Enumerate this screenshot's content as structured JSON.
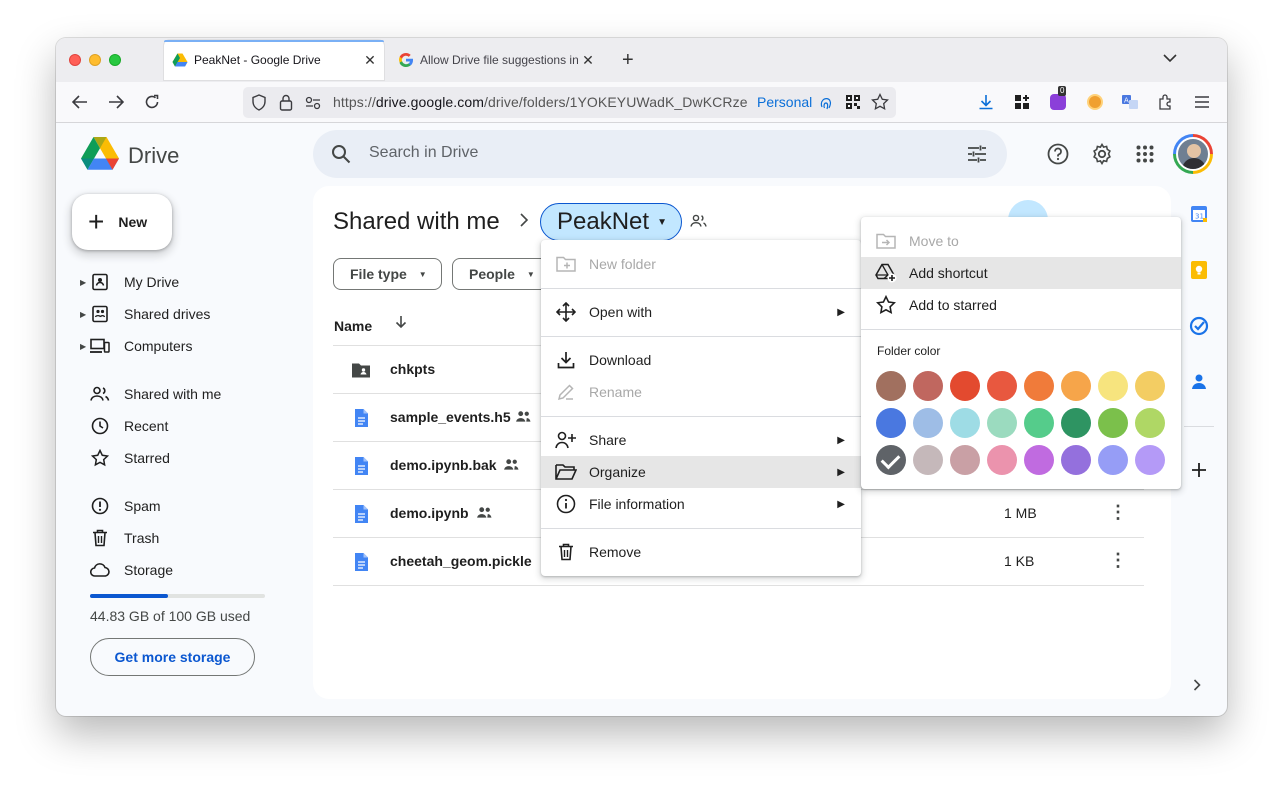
{
  "browser": {
    "tabs": [
      {
        "title": "PeakNet - Google Drive",
        "active": true
      },
      {
        "title": "Allow Drive file suggestions in C",
        "active": false
      }
    ],
    "url": "https://drive.google.com/drive/folders/1YOKEYUWadK_DwKCRze",
    "url_domain": "drive.google.com",
    "container_label": "Personal",
    "extension_badge": "0"
  },
  "drive": {
    "app_name": "Drive",
    "search_placeholder": "Search in Drive",
    "new_label": "New",
    "nav": [
      {
        "label": "My Drive",
        "icon": "my-drive-icon",
        "expandable": true
      },
      {
        "label": "Shared drives",
        "icon": "shared-drives-icon",
        "expandable": true
      },
      {
        "label": "Computers",
        "icon": "computers-icon",
        "expandable": true
      },
      {
        "label": "Shared with me",
        "icon": "shared-with-me-icon",
        "expandable": false
      },
      {
        "label": "Recent",
        "icon": "clock-icon",
        "expandable": false
      },
      {
        "label": "Starred",
        "icon": "star-icon",
        "expandable": false
      },
      {
        "label": "Spam",
        "icon": "spam-icon",
        "expandable": false
      },
      {
        "label": "Trash",
        "icon": "trash-icon",
        "expandable": false
      },
      {
        "label": "Storage",
        "icon": "cloud-icon",
        "expandable": false
      }
    ],
    "storage": {
      "used_text": "44.83 GB of 100 GB used",
      "used_fraction": 0.4483,
      "button": "Get more storage"
    },
    "breadcrumb": {
      "root": "Shared with me",
      "current": "PeakNet"
    },
    "filters": [
      "File type",
      "People"
    ],
    "columns": {
      "name": "Name"
    },
    "files": [
      {
        "name": "chkpts",
        "type": "shared-folder",
        "shared": false,
        "size": ""
      },
      {
        "name": "sample_events.h5",
        "type": "doc",
        "shared": true,
        "size": ""
      },
      {
        "name": "demo.ipynb.bak",
        "type": "doc",
        "shared": true,
        "size": ""
      },
      {
        "name": "demo.ipynb",
        "type": "doc",
        "shared": true,
        "size": "1 MB"
      },
      {
        "name": "cheetah_geom.pickle",
        "type": "doc",
        "shared": true,
        "size": "1 KB"
      }
    ]
  },
  "context_menu": {
    "items": [
      {
        "label": "New folder",
        "icon": "new-folder-icon",
        "disabled": true,
        "submenu": false
      },
      {
        "label": "Open with",
        "icon": "move-arrows-icon",
        "disabled": false,
        "submenu": true
      },
      {
        "label": "Download",
        "icon": "download-icon",
        "disabled": false,
        "submenu": false
      },
      {
        "label": "Rename",
        "icon": "pencil-icon",
        "disabled": true,
        "submenu": false
      },
      {
        "label": "Share",
        "icon": "person-add-icon",
        "disabled": false,
        "submenu": true
      },
      {
        "label": "Organize",
        "icon": "folder-open-icon",
        "disabled": false,
        "submenu": true,
        "highlighted": true
      },
      {
        "label": "File information",
        "icon": "info-icon",
        "disabled": false,
        "submenu": true
      },
      {
        "label": "Remove",
        "icon": "trash-icon",
        "disabled": false,
        "submenu": false
      }
    ]
  },
  "organize_menu": {
    "items": [
      {
        "label": "Move to",
        "icon": "move-to-icon",
        "disabled": true
      },
      {
        "label": "Add shortcut",
        "icon": "add-shortcut-icon",
        "disabled": false,
        "highlighted": true
      },
      {
        "label": "Add to starred",
        "icon": "star-icon",
        "disabled": false
      }
    ],
    "folder_color_label": "Folder color",
    "colors": [
      "#a1705f",
      "#c0675f",
      "#e34a2f",
      "#e8583f",
      "#f07b3a",
      "#f6a54a",
      "#f7e47e",
      "#f3cd63",
      "#4a78e0",
      "#9ebde6",
      "#9edce5",
      "#9bdbbf",
      "#55cc8b",
      "#2e9462",
      "#7bc04b",
      "#afd765",
      "#5f6368",
      "#c5b8ba",
      "#c9a0a5",
      "#eb93ad",
      "#c06be0",
      "#9470dd",
      "#969df6",
      "#b49af7"
    ],
    "selected_color_index": 16
  }
}
